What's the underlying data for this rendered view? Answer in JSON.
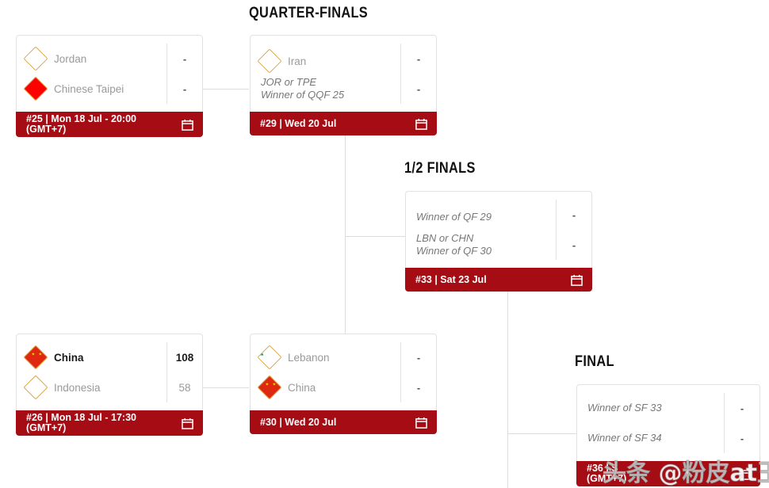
{
  "rounds": [
    {
      "id": "qf",
      "title": "QUARTER-FINALS"
    },
    {
      "id": "sf",
      "title": "1/2 FINALS"
    },
    {
      "id": "final",
      "title": "FINAL"
    }
  ],
  "matches": {
    "m25": {
      "number": "#25",
      "footer_line1": "#25 | Mon 18 Jul - 20:00",
      "footer_line2": "(GMT+7)",
      "calendar_icon": "calendar-icon",
      "teams": [
        {
          "name": "Jordan",
          "flag": "jordan-flag",
          "score": "-",
          "winner": false
        },
        {
          "name": "Chinese Taipei",
          "flag": "chinese-taipei-flag",
          "score": "-",
          "winner": false
        }
      ]
    },
    "m26": {
      "number": "#26",
      "footer_line1": "#26 | Mon 18 Jul - 17:30",
      "footer_line2": "(GMT+7)",
      "calendar_icon": "calendar-icon",
      "teams": [
        {
          "name": "China",
          "flag": "china-flag",
          "score": "108",
          "winner": true
        },
        {
          "name": "Indonesia",
          "flag": "indonesia-flag",
          "score": "58",
          "winner": false
        }
      ]
    },
    "m29": {
      "number": "#29",
      "footer_line1": "#29 | Wed 20 Jul",
      "footer_line2": "",
      "calendar_icon": "calendar-icon",
      "teams": [
        {
          "name": "Iran",
          "flag": "iran-flag",
          "score": "-",
          "winner": false
        }
      ],
      "placeholder": {
        "line1": "JOR or TPE",
        "line2": "Winner of QQF 25",
        "score": "-"
      }
    },
    "m30": {
      "number": "#30",
      "footer_line1": "#30 | Wed 20 Jul",
      "footer_line2": "",
      "calendar_icon": "calendar-icon",
      "teams": [
        {
          "name": "Lebanon",
          "flag": "lebanon-flag",
          "score": "-",
          "winner": false
        },
        {
          "name": "China",
          "flag": "china-flag",
          "score": "-",
          "winner": false
        }
      ]
    },
    "m33": {
      "number": "#33",
      "footer_line1": "#33 | Sat 23 Jul",
      "footer_line2": "",
      "calendar_icon": "calendar-icon",
      "slot1": {
        "line1": "Winner of QF 29",
        "line2": "",
        "score": "-"
      },
      "slot2": {
        "line1": "LBN or CHN",
        "line2": "Winner of QF 30",
        "score": "-"
      }
    },
    "m36": {
      "number": "#36",
      "footer_line1": "#36 | S",
      "footer_line2": "(GMT+7)",
      "calendar_icon": "calendar-icon",
      "slot1": {
        "line1": "Winner of SF 33",
        "line2": "",
        "score": "-"
      },
      "slot2": {
        "line1": "Winner of SF 34",
        "line2": "",
        "score": "-"
      }
    }
  },
  "watermark": {
    "text": "头条 @粉皮at王"
  },
  "colors": {
    "footer_red": "#a60c14",
    "card_border": "#e2e2e2",
    "connector": "#dcdcdc",
    "team_gray": "#9a9a9a",
    "winner_black": "#1a1a1a",
    "heading": "#111111"
  }
}
